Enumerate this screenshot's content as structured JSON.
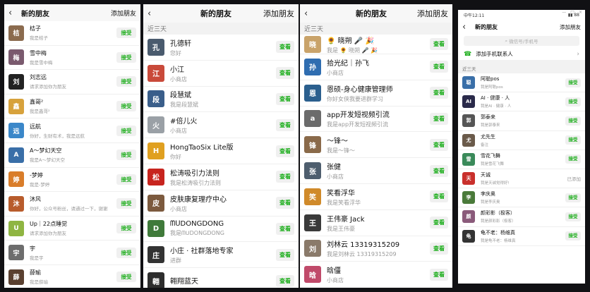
{
  "p1": {
    "back_icon": "‹",
    "title": "新的朋友",
    "action": "添加朋友",
    "accept": "接受",
    "items": [
      {
        "name": "桔子",
        "sub": "我是桔子",
        "color": "#8b6b4e",
        "glyph": "桔"
      },
      {
        "name": "雪中梅",
        "sub": "我是雪中梅",
        "color": "#7a5a6e",
        "glyph": "梅"
      },
      {
        "name": "刘志远",
        "sub": "请求添加你为朋友",
        "color": "#222",
        "glyph": "刘"
      },
      {
        "name": "鑫哥²",
        "sub": "我是鑫哥²",
        "color": "#d7a23c",
        "glyph": "鑫"
      },
      {
        "name": "远航",
        "sub": "你好，生财有术，我是远航",
        "color": "#3a87c9",
        "glyph": "远"
      },
      {
        "name": "A～梦幻天空",
        "sub": "我是A～梦幻天空",
        "color": "#3a6fa8",
        "glyph": "A"
      },
      {
        "name": "-梦婷",
        "sub": "我是-梦婷",
        "color": "#d97d2a",
        "glyph": "婷"
      },
      {
        "name": "沐风",
        "sub": "你好，公众号粉丝，请通过一下，谢谢",
        "color": "#b85c2c",
        "glyph": "沐"
      },
      {
        "name": "Up｜22点睡觉",
        "sub": "请求添加你为朋友",
        "color": "#8fb542",
        "glyph": "U"
      },
      {
        "name": "宇",
        "sub": "我是宇",
        "color": "#6d6d6d",
        "glyph": "宇"
      },
      {
        "name": "薛瑜",
        "sub": "我是薛瑜",
        "color": "#5a4030",
        "glyph": "薛"
      }
    ]
  },
  "p2": {
    "back_icon": "‹",
    "title": "新的朋友",
    "action": "添加朋友",
    "section": "近三天",
    "view": "查看",
    "items": [
      {
        "name": "孔德轩",
        "sub": "您好",
        "color": "#4a5b6e",
        "glyph": "孔"
      },
      {
        "name": "小江",
        "sub": "小商店",
        "color": "#c94a3a",
        "glyph": "江"
      },
      {
        "name": "段慧斌",
        "sub": "我是段慧斌",
        "color": "#3a5e8a",
        "glyph": "段"
      },
      {
        "name": "#倍儿火",
        "sub": "小商店",
        "color": "#9aa0a6",
        "glyph": "火"
      },
      {
        "name": "HongTaoSix Lite版",
        "sub": "你好",
        "color": "#e0a020",
        "glyph": "H"
      },
      {
        "name": "松涛吸引力法则",
        "sub": "我是松涛吸引力法则",
        "color": "#c7241e",
        "glyph": "松"
      },
      {
        "name": "皮肤康复理疗中心",
        "sub": "小商店",
        "color": "#7c5a3e",
        "glyph": "皮"
      },
      {
        "name": "ᗰᑌDONGDONG",
        "sub": "我是ᗰᑌDONGDONG",
        "color": "#3f7a3a",
        "glyph": "D"
      },
      {
        "name": "小庄 · 社群落地专家",
        "sub": "进群",
        "color": "#333",
        "glyph": "庄"
      },
      {
        "name": "翱翔蓝天",
        "sub": "",
        "color": "#2d2d2d",
        "glyph": "翱"
      }
    ]
  },
  "p3": {
    "back_icon": "‹",
    "title": "新的朋友",
    "action": "添加朋友",
    "section": "近三天",
    "view": "查看",
    "items": [
      {
        "name": "🌻 晓朔 🎤 🎉",
        "sub": "我是 🌻 晓朔 🎤 🎉",
        "color": "#c9a36a",
        "glyph": "晓"
      },
      {
        "name": "拾光纪｜孙飞",
        "sub": "小商店",
        "color": "#2f6db0",
        "glyph": "孙"
      },
      {
        "name": "恩硕-身心健康管理师",
        "sub": "你好女侠我要进群学习",
        "color": "#2b5f8e",
        "glyph": "恩"
      },
      {
        "name": "app开发短视频引流",
        "sub": "我是app开发短视频引流",
        "color": "#6b6b6b",
        "glyph": "a"
      },
      {
        "name": "～锋～",
        "sub": "我是～锋～",
        "color": "#8a6a4a",
        "glyph": "锋"
      },
      {
        "name": "张健",
        "sub": "小商店",
        "color": "#4e5e6e",
        "glyph": "张"
      },
      {
        "name": "笑看浮华",
        "sub": "我是笑看浮华",
        "color": "#d08a2a",
        "glyph": "笑"
      },
      {
        "name": "王伟豪 Jack",
        "sub": "我是王伟豪",
        "color": "#3a3a3a",
        "glyph": "王"
      },
      {
        "name": "刘林云 13319315209",
        "sub": "我是刘林云 13319315209",
        "color": "#8a7a6a",
        "glyph": "刘"
      },
      {
        "name": "晗僵",
        "sub": "小商店",
        "color": "#c04a6a",
        "glyph": "晗"
      }
    ]
  },
  "p4": {
    "status_time": "中午12:11",
    "status_right": "▮▮ 88",
    "back_icon": "‹",
    "title": "新的朋友",
    "action": "添加朋友",
    "search_placeholder": "微信号/手机号",
    "add_phone": "添加手机联系人",
    "section": "近三天",
    "accept": "接受",
    "added": "已添加",
    "items": [
      {
        "name": "阿聪pos",
        "sub": "我是阿聪pos",
        "color": "#3a6fa8",
        "glyph": "聪",
        "state": "accept"
      },
      {
        "name": "AI · 健康 · 人",
        "sub": "我是AI · 健康 · 人",
        "color": "#2a2a4a",
        "glyph": "AI",
        "state": "accept"
      },
      {
        "name": "郭泰来",
        "sub": "我是郭泰来",
        "color": "#555",
        "glyph": "郭",
        "state": "accept"
      },
      {
        "name": "尤先生",
        "sub": "备注",
        "color": "#6a5a4a",
        "glyph": "尤",
        "state": "accept"
      },
      {
        "name": "雪花飞舞",
        "sub": "我是雪花飞舞",
        "color": "#3a8a5a",
        "glyph": "雪",
        "state": "accept"
      },
      {
        "name": "天诚",
        "sub": "我是天诚觉得好!",
        "color": "#c9302c",
        "glyph": "天",
        "state": "added"
      },
      {
        "name": "李庆奥",
        "sub": "我是李庆奥",
        "color": "#4a7a3a",
        "glyph": "李",
        "state": "accept"
      },
      {
        "name": "颜彩影（极客）",
        "sub": "我是颜彩影（极客）",
        "color": "#8a5a7a",
        "glyph": "颜",
        "state": "accept"
      },
      {
        "name": "龟不老：杨维真",
        "sub": "我是龟不老：杨维真",
        "color": "#333",
        "glyph": "龟",
        "state": "accept"
      }
    ]
  }
}
